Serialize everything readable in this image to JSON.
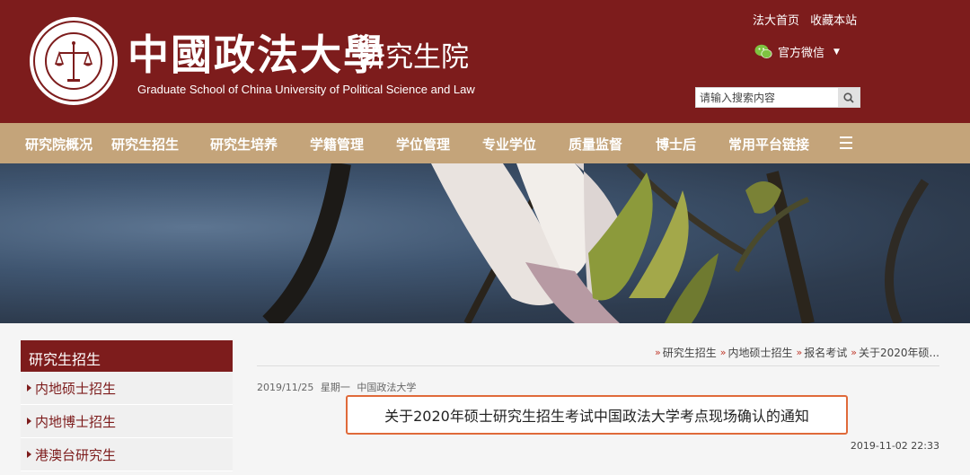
{
  "header": {
    "seal_text": "中國政法大學 CHINA UNIVERSITY OF POLITICAL SCIENCE AND LAW",
    "brand_cn": "中國政法大學",
    "brand_sub": "研究生院",
    "brand_en": "Graduate School of China University of Political Science and Law",
    "top_links": [
      "法大首页",
      "收藏本站"
    ],
    "wechat_label": "官方微信",
    "search_placeholder": "请输入搜索内容",
    "colors": {
      "header_bg": "#7d1c1c",
      "nav_bg": "#c4a47a"
    }
  },
  "nav": {
    "items": [
      "研究院概况",
      "研究生招生",
      "研究生培养",
      "学籍管理",
      "学位管理",
      "专业学位",
      "质量监督",
      "博士后",
      "常用平台链接"
    ],
    "menu_icon": "hamburger-icon"
  },
  "sidebar": {
    "title": "研究生招生",
    "items": [
      "内地硕士招生",
      "内地博士招生",
      "港澳台研究生"
    ]
  },
  "main": {
    "breadcrumb": [
      "研究生招生",
      "内地硕士招生",
      "报名考试",
      "关于2020年硕..."
    ],
    "meta_date": "2019/11/25",
    "meta_weekday": "星期一",
    "meta_source": "中国政法大学",
    "article_title": "关于2020年硕士研究生招生考试中国政法大学考点现场确认的通知",
    "publish_time": "2019-11-02 22:33"
  }
}
